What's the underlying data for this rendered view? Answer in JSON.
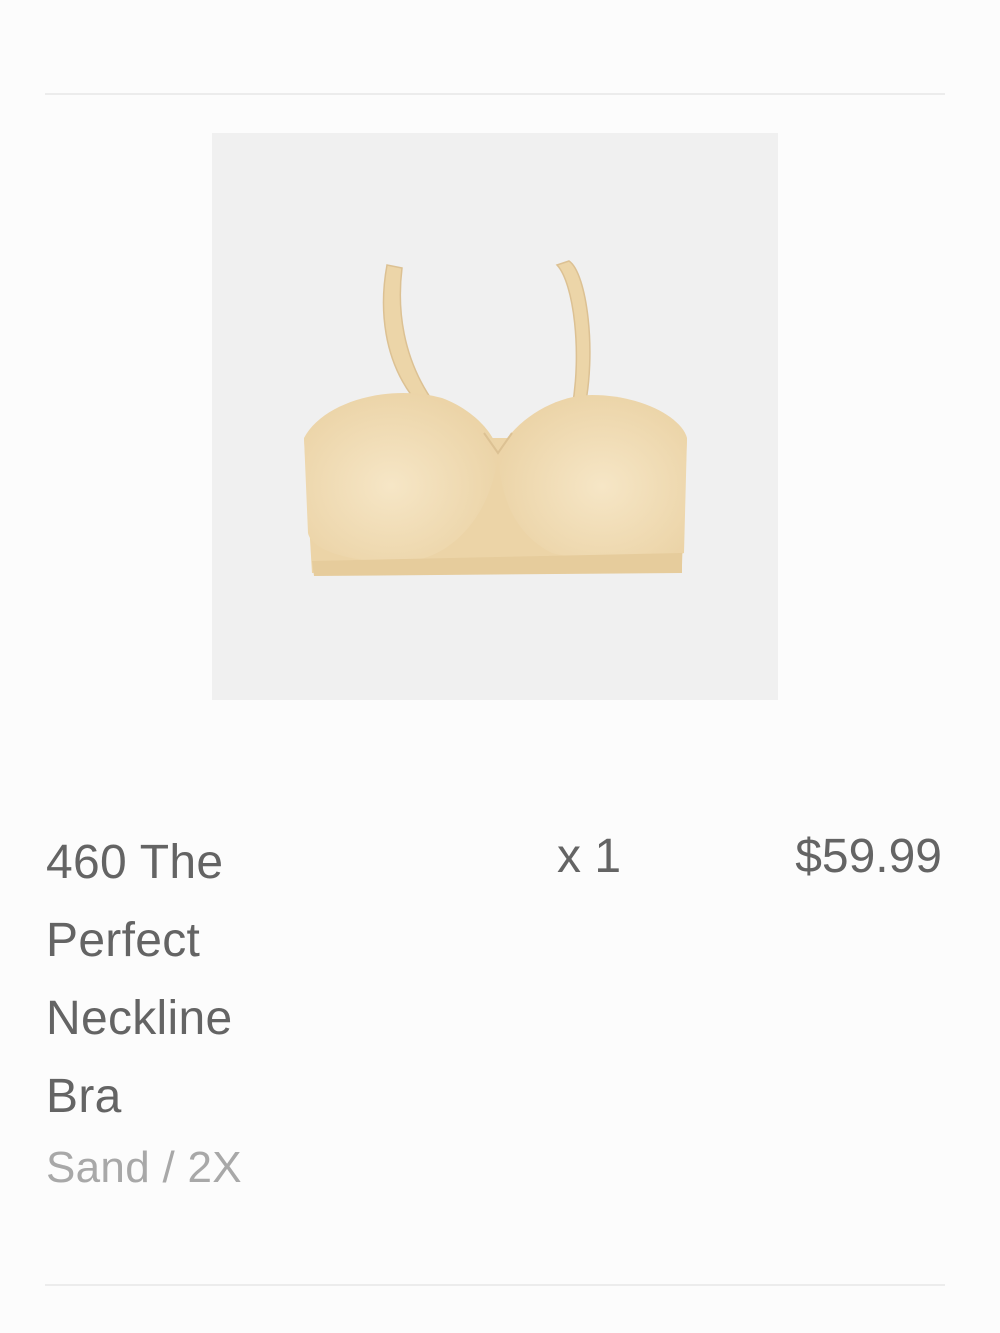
{
  "cart_item": {
    "name": "460 The Perfect Neckline Bra",
    "variant": "Sand / 2X",
    "quantity": "x 1",
    "price": "$59.99",
    "image": {
      "icon": "product-photo",
      "background_color": "#f0f0f0",
      "product_color": "#f2ddb5"
    }
  },
  "colors": {
    "text_primary": "#646464",
    "text_secondary": "#a8a8a8",
    "divider": "#ececec"
  }
}
